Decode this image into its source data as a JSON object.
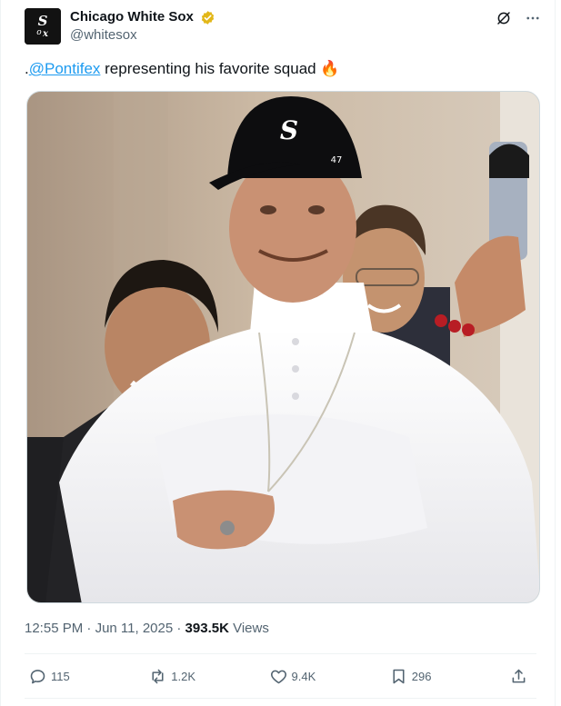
{
  "account": {
    "display_name": "Chicago White Sox",
    "handle": "@whitesox",
    "avatar_text": "Sox"
  },
  "tweet": {
    "text_prefix": ".",
    "mention": "@Pontifex",
    "text_body": " representing his favorite squad ",
    "emoji": "🔥"
  },
  "meta": {
    "time": "12:55 PM",
    "separator": " · ",
    "date": "Jun 11, 2025",
    "views_count": "393.5K",
    "views_label": " Views"
  },
  "actions": {
    "replies": "115",
    "reposts": "1.2K",
    "likes": "9.4K",
    "bookmarks": "296"
  },
  "colors": {
    "accent": "#1d9bf0",
    "verified": "#e2b719",
    "muted": "#536471"
  }
}
